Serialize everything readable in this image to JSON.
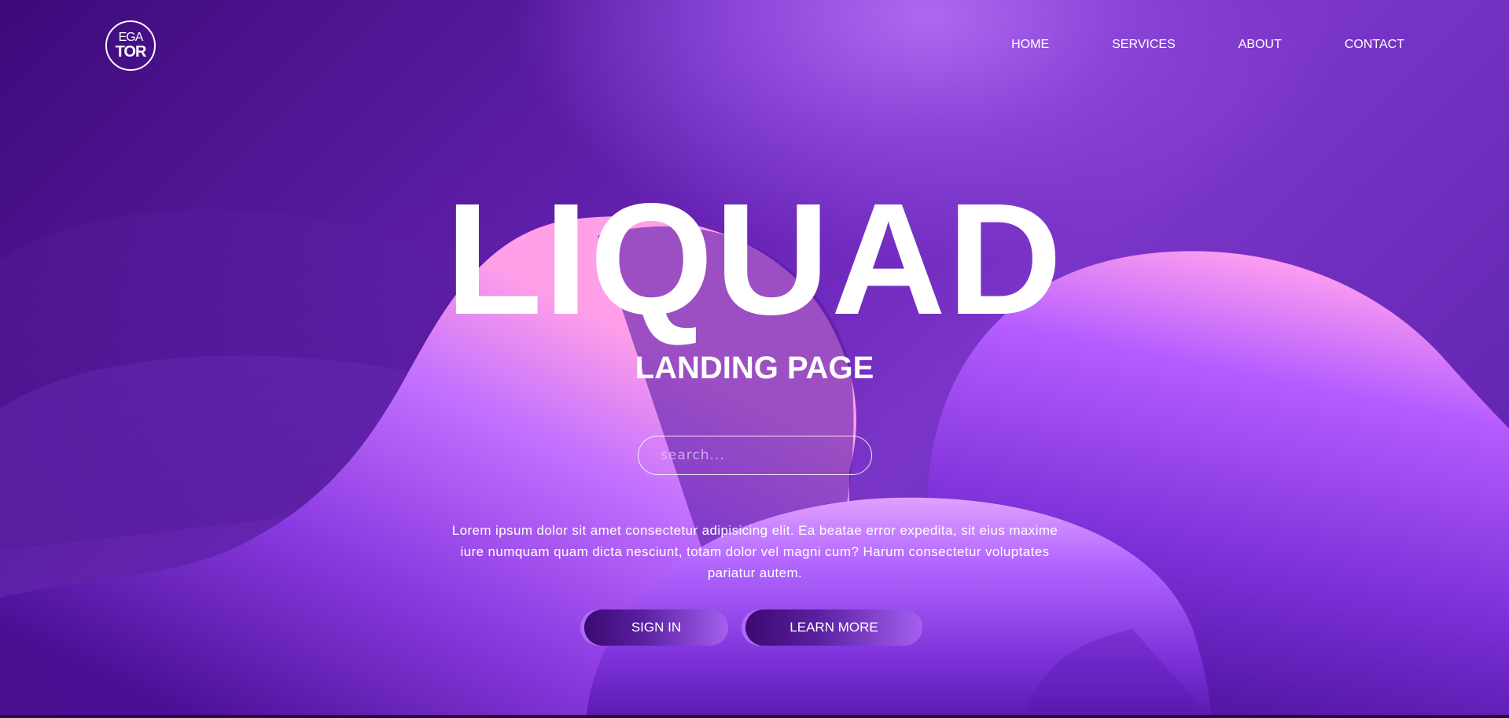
{
  "logo": {
    "top": "EGA",
    "bottom": "TOR"
  },
  "nav": {
    "items": [
      {
        "label": "HOME"
      },
      {
        "label": "SERVICES"
      },
      {
        "label": "ABOUT"
      },
      {
        "label": "CONTACT"
      }
    ]
  },
  "hero": {
    "title": "LIQUAD",
    "subtitle": "LANDING PAGE",
    "description": "Lorem ipsum dolor sit amet consectetur adipisicing elit. Ea beatae error expedita, sit eius maxime iure numquam quam dicta nesciunt, totam dolor vel magni cum? Harum consectetur voluptates pariatur autem."
  },
  "search": {
    "placeholder": "search..."
  },
  "buttons": {
    "sign_in": "SIGN IN",
    "learn_more": "LEARN MORE"
  },
  "colors": {
    "background_deep": "#3d0a7a",
    "background_mid": "#7a35c8",
    "blob_highlight": "#ff9ff0",
    "blob_violet": "#b15cff",
    "text": "#ffffff"
  }
}
